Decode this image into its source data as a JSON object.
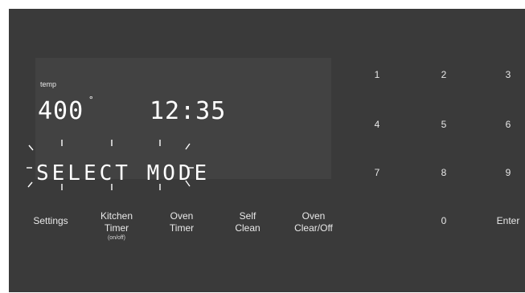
{
  "display": {
    "temp_label": "temp",
    "temperature": "400",
    "degree": "°",
    "time": "12:35",
    "message": "SELECT MODE"
  },
  "buttons": {
    "settings": "Settings",
    "kitchen_timer_line1": "Kitchen",
    "kitchen_timer_line2": "Timer",
    "kitchen_timer_sub": "(on/off)",
    "oven_timer_line1": "Oven",
    "oven_timer_line2": "Timer",
    "self_clean_line1": "Self",
    "self_clean_line2": "Clean",
    "oven_clear_line1": "Oven",
    "oven_clear_line2": "Clear/Off"
  },
  "keypad": {
    "k1": "1",
    "k2": "2",
    "k3": "3",
    "k4": "4",
    "k5": "5",
    "k6": "6",
    "k7": "7",
    "k8": "8",
    "k9": "9",
    "k0": "0",
    "enter": "Enter"
  },
  "colors": {
    "panel": "#3a3a3a",
    "display": "#424242",
    "segment": "#ffffff"
  }
}
